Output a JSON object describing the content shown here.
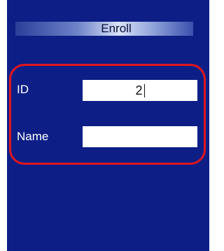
{
  "window": {
    "title": "Enroll"
  },
  "form": {
    "id_label": "ID",
    "id_value": "2",
    "name_label": "Name",
    "name_value": ""
  },
  "colors": {
    "background": "#0d1f86",
    "highlight_border": "#e0161e",
    "label_text": "#ffffff",
    "input_background": "#ffffff"
  }
}
